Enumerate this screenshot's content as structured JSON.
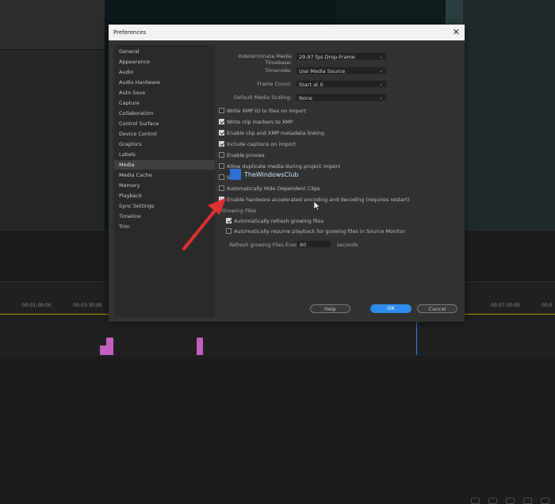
{
  "dialog": {
    "title": "Preferences",
    "close_glyph": "✕"
  },
  "sidebar": {
    "items": [
      {
        "label": "General"
      },
      {
        "label": "Appearance"
      },
      {
        "label": "Audio"
      },
      {
        "label": "Audio Hardware"
      },
      {
        "label": "Auto Save"
      },
      {
        "label": "Capture"
      },
      {
        "label": "Collaboration"
      },
      {
        "label": "Control Surface"
      },
      {
        "label": "Device Control"
      },
      {
        "label": "Graphics"
      },
      {
        "label": "Labels"
      },
      {
        "label": "Media",
        "selected": true
      },
      {
        "label": "Media Cache"
      },
      {
        "label": "Memory"
      },
      {
        "label": "Playback"
      },
      {
        "label": "Sync Settings"
      },
      {
        "label": "Timeline"
      },
      {
        "label": "Trim"
      }
    ]
  },
  "media": {
    "fields": [
      {
        "label": "Indeterminate Media Timebase:",
        "value": "29.97 fps Drop-Frame"
      },
      {
        "label": "Timecode:",
        "value": "Use Media Source"
      },
      {
        "label": "Frame Count:",
        "value": "Start at 0"
      },
      {
        "label": "Default Media Scaling:",
        "value": "None"
      }
    ],
    "checkboxes": [
      {
        "label": "Write XMP ID to files on import",
        "checked": false
      },
      {
        "label": "Write clip markers to XMP",
        "checked": true
      },
      {
        "label": "Enable clip and XMP metadata linking",
        "checked": true
      },
      {
        "label": "Include captions on import",
        "checked": true
      },
      {
        "label": "Enable proxies",
        "checked": false
      },
      {
        "label": "Allow duplicate media during project import",
        "checked": false
      },
      {
        "label": "S",
        "checked": false
      },
      {
        "label": "Automatically Hide Dependent Clips",
        "checked": false
      },
      {
        "label": "Enable hardware accelerated encoding and decoding (requires restart)",
        "checked": true
      }
    ],
    "growing_files": {
      "heading": "Growing Files",
      "auto_refresh": {
        "label": "Automatically refresh growing files",
        "checked": true
      },
      "auto_resume": {
        "label": "Automatically resume playback for growing files in Source Monitor",
        "checked": false
      },
      "refresh_every_label": "Refresh growing Files Every",
      "refresh_every_value": "60",
      "refresh_unit": "seconds"
    }
  },
  "buttons": {
    "help": "Help",
    "ok": "OK",
    "cancel": "Cancel"
  },
  "watermark": {
    "text": "TheWindowsClub"
  },
  "timeline": {
    "timecodes": [
      "00:01:00:00",
      "00:03:30:00",
      "00:07:30:00",
      "00:0"
    ]
  },
  "colors": {
    "accent": "#2d8ceb",
    "annotation_arrow": "#e03030",
    "clip": "#c25fc0"
  }
}
